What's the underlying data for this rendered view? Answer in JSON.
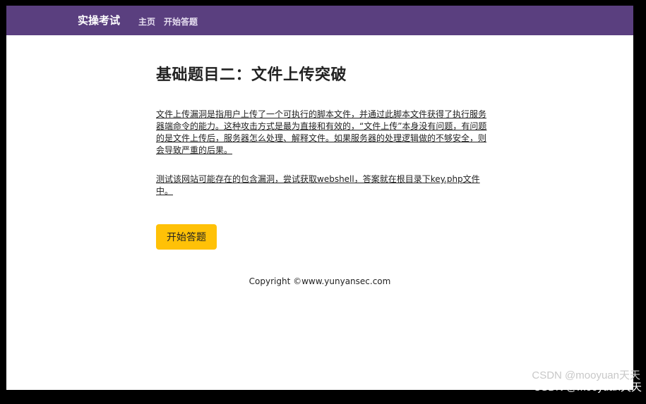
{
  "navbar": {
    "brand": "实操考试",
    "home": "主页",
    "start": "开始答题"
  },
  "main": {
    "title": "基础题目二：文件上传突破",
    "paragraph1": "文件上传漏洞是指用户上传了一个可执行的脚本文件，并通过此脚本文件获得了执行服务器端命令的能力。这种攻击方式是最为直接和有效的，“文件上传”本身没有问题，有问题的是文件上传后，服务器怎么处理、解释文件。如果服务器的处理逻辑做的不够安全，则会导致严重的后果。",
    "paragraph2": "测试该网站可能存在的包含漏洞，尝试获取webshell，答案就在根目录下key.php文件中。",
    "start_button": "开始答题"
  },
  "footer": {
    "copyright": "Copyright ©www.yunyansec.com"
  },
  "watermark": {
    "line1": "CSDN @mooyuan天天",
    "line2": "CSDN @mooyuan天天"
  },
  "colors": {
    "navbar": "#5a3f7f",
    "button": "#ffc107"
  }
}
